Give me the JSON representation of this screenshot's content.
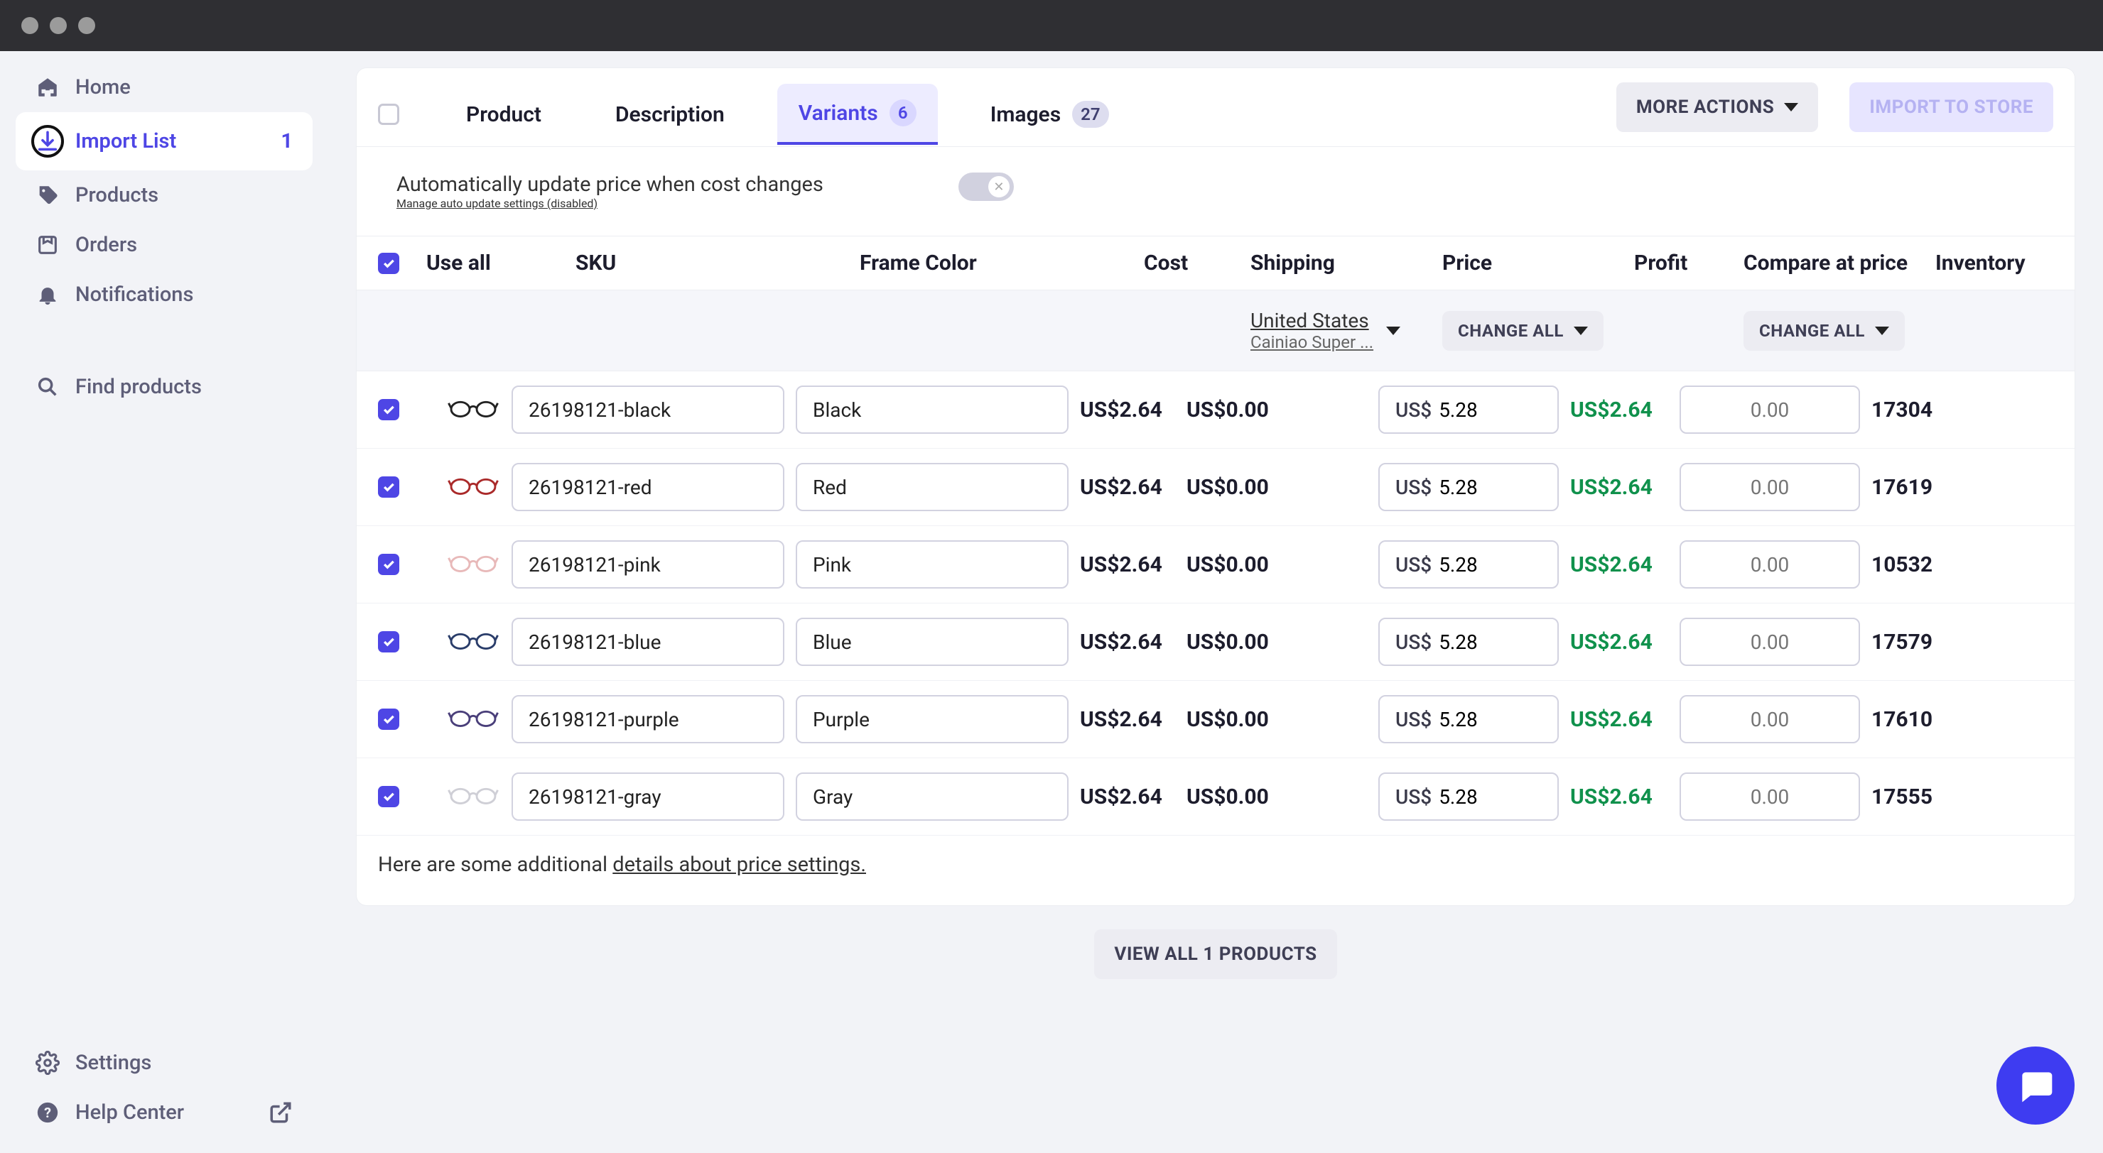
{
  "sidebar": {
    "items": [
      {
        "label": "Home"
      },
      {
        "label": "Import List",
        "count": "1"
      },
      {
        "label": "Products"
      },
      {
        "label": "Orders"
      },
      {
        "label": "Notifications"
      }
    ],
    "find": "Find products",
    "settings": "Settings",
    "help": "Help Center"
  },
  "tabs": {
    "product": "Product",
    "description": "Description",
    "variants": "Variants",
    "variants_count": "6",
    "images": "Images",
    "images_count": "27"
  },
  "actions": {
    "more": "MORE ACTIONS",
    "import": "IMPORT TO STORE",
    "change_all": "CHANGE ALL",
    "view_all": "VIEW ALL 1 PRODUCTS"
  },
  "autoupdate": {
    "line1": "Automatically update price when cost changes",
    "link": "Manage auto update settings (disabled)"
  },
  "columns": {
    "use_all": "Use all",
    "sku": "SKU",
    "frame_color": "Frame Color",
    "cost": "Cost",
    "shipping": "Shipping",
    "price": "Price",
    "profit": "Profit",
    "compare": "Compare at price",
    "inventory": "Inventory"
  },
  "shipping_select": {
    "country": "United States",
    "carrier": "Cainiao Super ..."
  },
  "price_prefix": "US$",
  "compare_placeholder": "0.00",
  "rows": [
    {
      "sku": "26198121-black",
      "color": "Black",
      "glasses_color": "#222",
      "cost": "US$2.64",
      "ship": "US$0.00",
      "price": "5.28",
      "profit": "US$2.64",
      "inv": "17304"
    },
    {
      "sku": "26198121-red",
      "color": "Red",
      "glasses_color": "#aa2a2a",
      "cost": "US$2.64",
      "ship": "US$0.00",
      "price": "5.28",
      "profit": "US$2.64",
      "inv": "17619"
    },
    {
      "sku": "26198121-pink",
      "color": "Pink",
      "glasses_color": "#e8b9b9",
      "cost": "US$2.64",
      "ship": "US$0.00",
      "price": "5.28",
      "profit": "US$2.64",
      "inv": "10532"
    },
    {
      "sku": "26198121-blue",
      "color": "Blue",
      "glasses_color": "#2a3d6a",
      "cost": "US$2.64",
      "ship": "US$0.00",
      "price": "5.28",
      "profit": "US$2.64",
      "inv": "17579"
    },
    {
      "sku": "26198121-purple",
      "color": "Purple",
      "glasses_color": "#4a3f7a",
      "cost": "US$2.64",
      "ship": "US$0.00",
      "price": "5.28",
      "profit": "US$2.64",
      "inv": "17610"
    },
    {
      "sku": "26198121-gray",
      "color": "Gray",
      "glasses_color": "#cfcfd6",
      "cost": "US$2.64",
      "ship": "US$0.00",
      "price": "5.28",
      "profit": "US$2.64",
      "inv": "17555"
    }
  ],
  "footnote": {
    "prefix": "Here are some additional ",
    "link": "details about price settings."
  }
}
